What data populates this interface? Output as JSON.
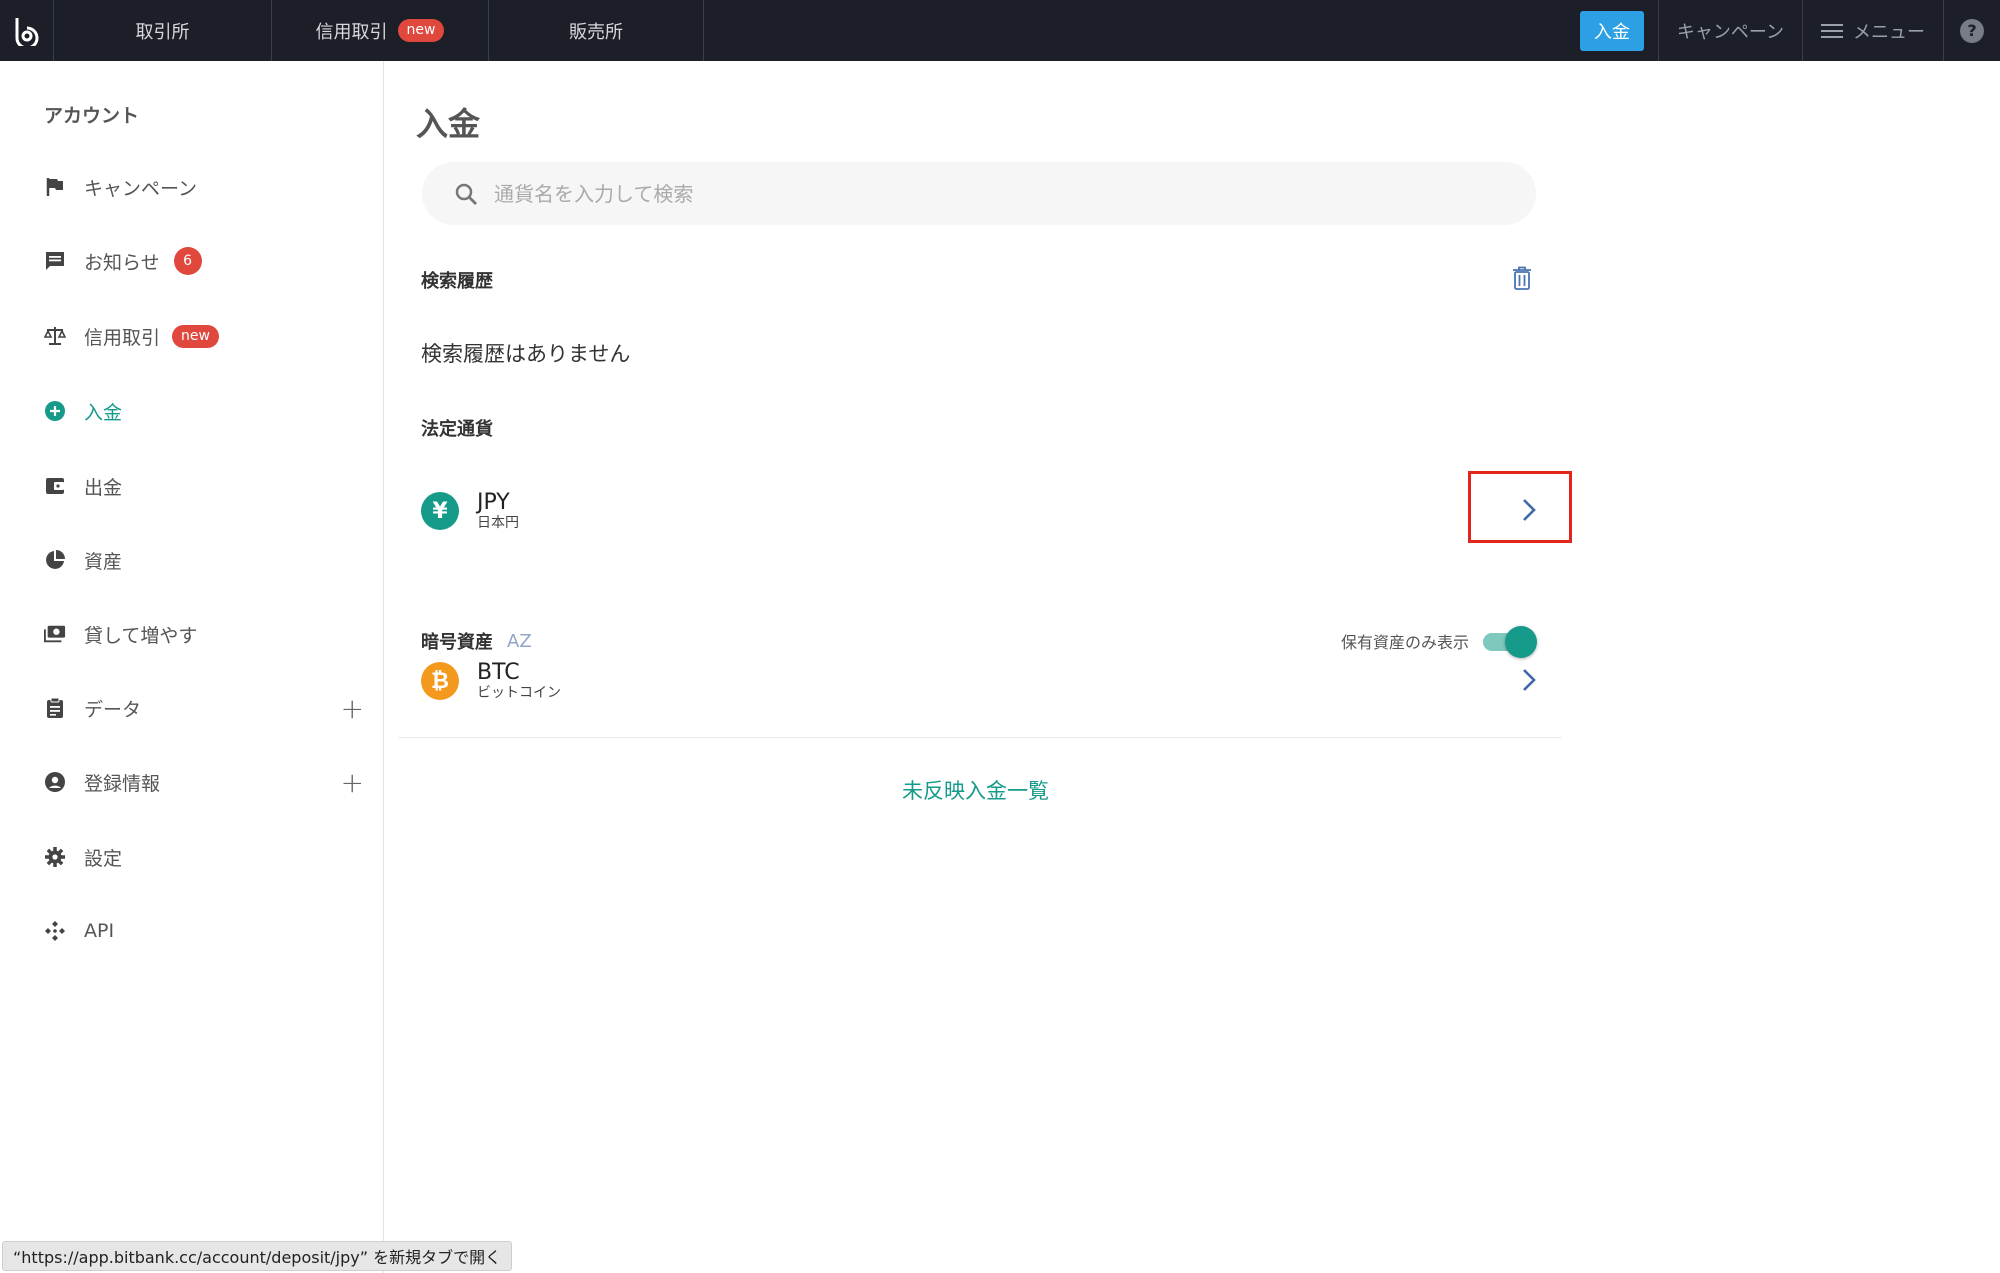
{
  "header": {
    "nav": [
      {
        "label": "取引所"
      },
      {
        "label": "信用取引",
        "badge": "new"
      },
      {
        "label": "販売所"
      }
    ],
    "deposit_label": "入金",
    "campaign_label": "キャンペーン",
    "menu_label": "メニュー",
    "help_label": "?"
  },
  "sidebar": {
    "title": "アカウント",
    "items": [
      {
        "label": "キャンペーン",
        "icon": "flag-icon"
      },
      {
        "label": "お知らせ",
        "icon": "message-icon",
        "count": "6"
      },
      {
        "label": "信用取引",
        "icon": "scale-icon",
        "badge": "new"
      },
      {
        "label": "入金",
        "icon": "plus-circle-icon",
        "active": true
      },
      {
        "label": "出金",
        "icon": "wallet-icon"
      },
      {
        "label": "資産",
        "icon": "pie-chart-icon"
      },
      {
        "label": "貸して増やす",
        "icon": "money-icon"
      },
      {
        "label": "データ",
        "icon": "clipboard-icon",
        "expand": "+"
      },
      {
        "label": "登録情報",
        "icon": "account-circle-icon",
        "expand": "+"
      },
      {
        "label": "設定",
        "icon": "gear-icon"
      },
      {
        "label": "API",
        "icon": "api-icon"
      }
    ]
  },
  "main": {
    "title": "入金",
    "search_placeholder": "通貨名を入力して検索",
    "history_label": "検索履歴",
    "history_empty": "検索履歴はありません",
    "fiat_label": "法定通貨",
    "fiat": [
      {
        "code": "JPY",
        "name": "日本円",
        "symbol": "¥",
        "color": "#169b8a"
      }
    ],
    "crypto_label": "暗号資産",
    "sort_label": "AZ",
    "holdings_only_label": "保有資産のみ表示",
    "holdings_only_on": true,
    "crypto": [
      {
        "code": "BTC",
        "name": "ビットコイン",
        "symbol": "₿",
        "color": "#f39a1e"
      }
    ],
    "pending_link": "未反映入金一覧"
  },
  "status_bar": {
    "text": "“https://app.bitbank.cc/account/deposit/jpy” を新規タブで開く"
  },
  "colors": {
    "accent": "#169b8a",
    "header_bg": "#1c1f28",
    "deposit_button": "#2d9fe5",
    "badge": "#e0483e",
    "highlight": "#e3261b"
  }
}
